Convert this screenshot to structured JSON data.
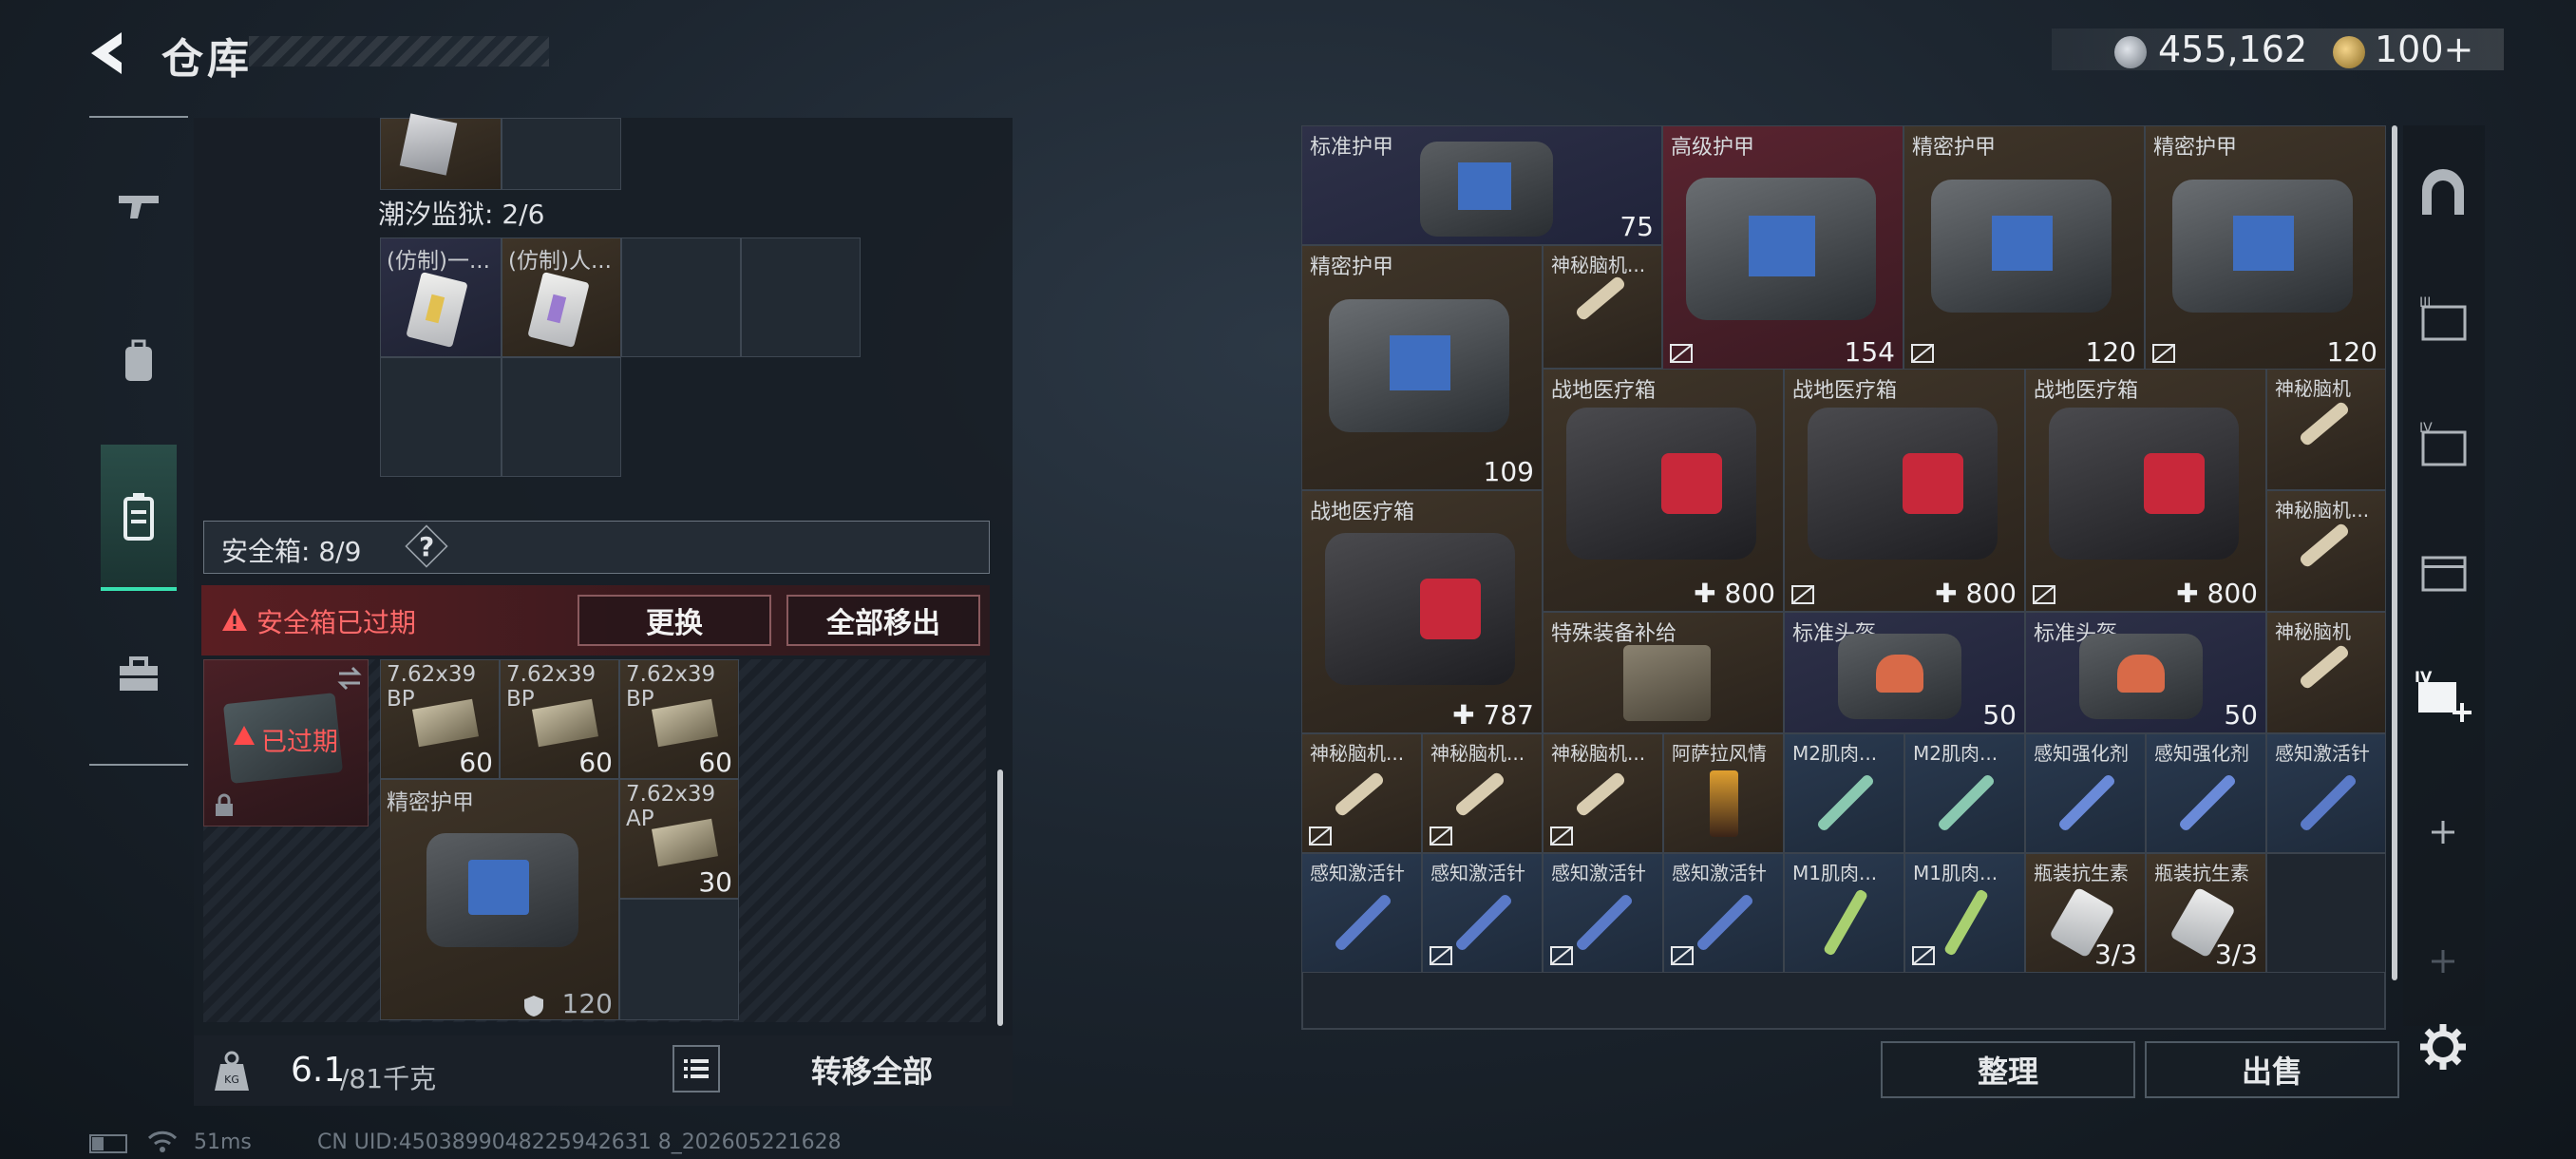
{
  "header": {
    "title": "仓库",
    "currency": [
      {
        "icon": "silver-coin-icon",
        "value": "455,162"
      },
      {
        "icon": "gold-coin-icon",
        "value": "100+"
      }
    ]
  },
  "left_tabs": [
    {
      "icon": "gun-icon"
    },
    {
      "icon": "backpack-icon"
    },
    {
      "icon": "safe-box-icon",
      "active": true
    },
    {
      "icon": "toolbox-icon"
    }
  ],
  "left_panel": {
    "prison_label": "潮汐监狱: 2/6",
    "prison_items": [
      "(仿制)一...",
      "(仿制)人..."
    ],
    "safe_box_label": "安全箱: 8/9",
    "help": "?",
    "warning": "安全箱已过期",
    "replace_btn": "更换",
    "remove_all_btn": "全部移出",
    "expired_tag": "已过期",
    "items": [
      {
        "name": "7.62x39\nBP",
        "qty": "60"
      },
      {
        "name": "7.62x39\nBP",
        "qty": "60"
      },
      {
        "name": "7.62x39\nBP",
        "qty": "60"
      },
      {
        "name": "精密护甲",
        "qty": "120"
      },
      {
        "name": "7.62x39\nAP",
        "qty": "30"
      }
    ],
    "weight_value": "6.1",
    "weight_max": "/81千克",
    "transfer_all_btn": "转移全部"
  },
  "right_grid": {
    "items": [
      {
        "name": "标准护甲",
        "val": "75"
      },
      {
        "name": "高级护甲",
        "val": "154"
      },
      {
        "name": "精密护甲",
        "val": "120"
      },
      {
        "name": "精密护甲",
        "val": "120"
      },
      {
        "name": "精密护甲",
        "val": "109"
      },
      {
        "name": "神秘脑机...",
        "val": ""
      },
      {
        "name": "战地医疗箱",
        "val": "800"
      },
      {
        "name": "战地医疗箱",
        "val": "800"
      },
      {
        "name": "战地医疗箱",
        "val": "800"
      },
      {
        "name": "神秘脑机",
        "val": ""
      },
      {
        "name": "战地医疗箱",
        "val": "787"
      },
      {
        "name": "神秘脑机...",
        "val": ""
      },
      {
        "name": "特殊装备补给",
        "val": ""
      },
      {
        "name": "标准头盔",
        "val": "50"
      },
      {
        "name": "标准头盔",
        "val": "50"
      },
      {
        "name": "神秘脑机",
        "val": ""
      },
      {
        "name": "神秘脑机...",
        "val": ""
      },
      {
        "name": "神秘脑机...",
        "val": ""
      },
      {
        "name": "神秘脑机...",
        "val": ""
      },
      {
        "name": "阿萨拉风情",
        "val": ""
      },
      {
        "name": "M2肌肉...",
        "val": ""
      },
      {
        "name": "M2肌肉...",
        "val": ""
      },
      {
        "name": "感知强化剂",
        "val": ""
      },
      {
        "name": "感知强化剂",
        "val": ""
      },
      {
        "name": "感知激活针",
        "val": ""
      },
      {
        "name": "感知激活针",
        "val": ""
      },
      {
        "name": "感知激活针",
        "val": ""
      },
      {
        "name": "感知激活针",
        "val": ""
      },
      {
        "name": "感知激活针",
        "val": ""
      },
      {
        "name": "M1肌肉...",
        "val": ""
      },
      {
        "name": "M1肌肉...",
        "val": ""
      },
      {
        "name": "瓶装抗生素",
        "val": "3/3"
      },
      {
        "name": "瓶装抗生素",
        "val": "3/3"
      }
    ],
    "sort_btn": "整理",
    "sell_btn": "出售"
  },
  "right_sidebar": [
    {
      "icon": "arch-icon"
    },
    {
      "icon": "case-III-icon"
    },
    {
      "icon": "case-IV-icon"
    },
    {
      "icon": "case-icon"
    },
    {
      "icon": "add-case-IV-icon"
    },
    {
      "icon": "plus-icon"
    },
    {
      "icon": "plus-icon"
    },
    {
      "icon": "gear-icon"
    }
  ],
  "footer": {
    "ping": "51ms",
    "uid": "CN UID:4503899048225942631 8_202605221628"
  }
}
